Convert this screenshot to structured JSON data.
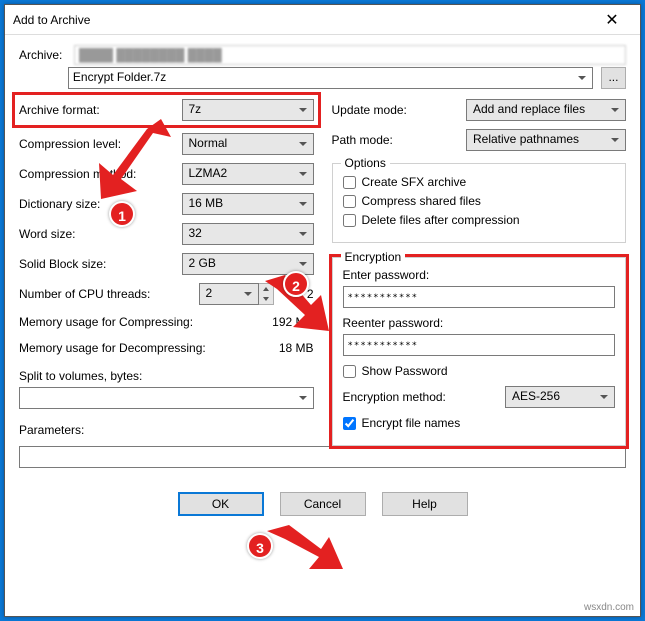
{
  "title": "Add to Archive",
  "archive_label": "Archive:",
  "archive_file": "Encrypt Folder.7z",
  "browse_dots": "...",
  "left": {
    "format_label": "Archive format:",
    "format_value": "7z",
    "level_label": "Compression level:",
    "level_value": "Normal",
    "method_label": "Compression method:",
    "method_value": "LZMA2",
    "dict_label": "Dictionary size:",
    "dict_value": "16 MB",
    "word_label": "Word size:",
    "word_value": "32",
    "solid_label": "Solid Block size:",
    "solid_value": "2 GB",
    "threads_label": "Number of CPU threads:",
    "threads_value": "2",
    "threads_max": "/ 2",
    "mem_c_label": "Memory usage for Compressing:",
    "mem_c_value": "192 MB",
    "mem_d_label": "Memory usage for Decompressing:",
    "mem_d_value": "18 MB",
    "split_label": "Split to volumes, bytes:",
    "params_label": "Parameters:"
  },
  "right": {
    "update_label": "Update mode:",
    "update_value": "Add and replace files",
    "path_label": "Path mode:",
    "path_value": "Relative pathnames",
    "options_legend": "Options",
    "opt_sfx": "Create SFX archive",
    "opt_shared": "Compress shared files",
    "opt_delete": "Delete files after compression",
    "enc_legend": "Encryption",
    "enc_pw_label": "Enter password:",
    "enc_pw_value": "***********",
    "enc_pw2_label": "Reenter password:",
    "enc_pw2_value": "***********",
    "enc_show": "Show Password",
    "enc_method_label": "Encryption method:",
    "enc_method_value": "AES-256",
    "enc_names": "Encrypt file names"
  },
  "buttons": {
    "ok": "OK",
    "cancel": "Cancel",
    "help": "Help"
  },
  "badges": {
    "b1": "1",
    "b2": "2",
    "b3": "3"
  },
  "watermark": "wsxdn.com"
}
